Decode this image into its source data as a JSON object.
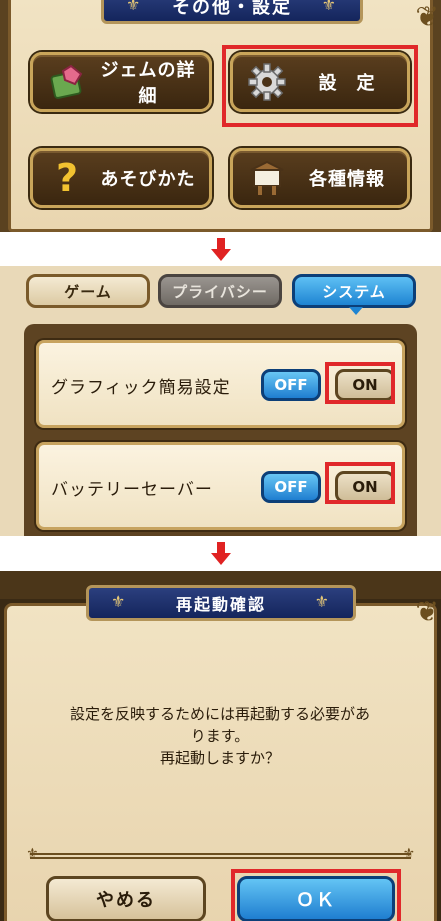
{
  "panel1": {
    "title": "その他・設定",
    "buttons": [
      {
        "label": "ジェムの詳細",
        "icon": "gem-book-icon"
      },
      {
        "label": "設　定",
        "icon": "gear-icon"
      },
      {
        "label": "あそびかた",
        "icon": "question-mark-icon"
      },
      {
        "label": "各種情報",
        "icon": "notice-board-icon"
      }
    ]
  },
  "panel2": {
    "tabs": {
      "game": "ゲーム",
      "privacy": "プライバシー",
      "system": "システム"
    },
    "settings": [
      {
        "label": "グラフィック簡易設定",
        "off": "OFF",
        "on": "ON"
      },
      {
        "label": "バッテリーセーバー",
        "off": "OFF",
        "on": "ON"
      }
    ]
  },
  "panel3": {
    "title": "再起動確認",
    "message": [
      "設定を反映するためには再起動する必要があ",
      "ります。",
      "再起動しますか？"
    ],
    "cancel": "やめる",
    "ok": "ＯＫ"
  },
  "colors": {
    "highlight": "#e0282a",
    "arrow": "#e02222",
    "accent_blue": "#1f7ed0"
  }
}
